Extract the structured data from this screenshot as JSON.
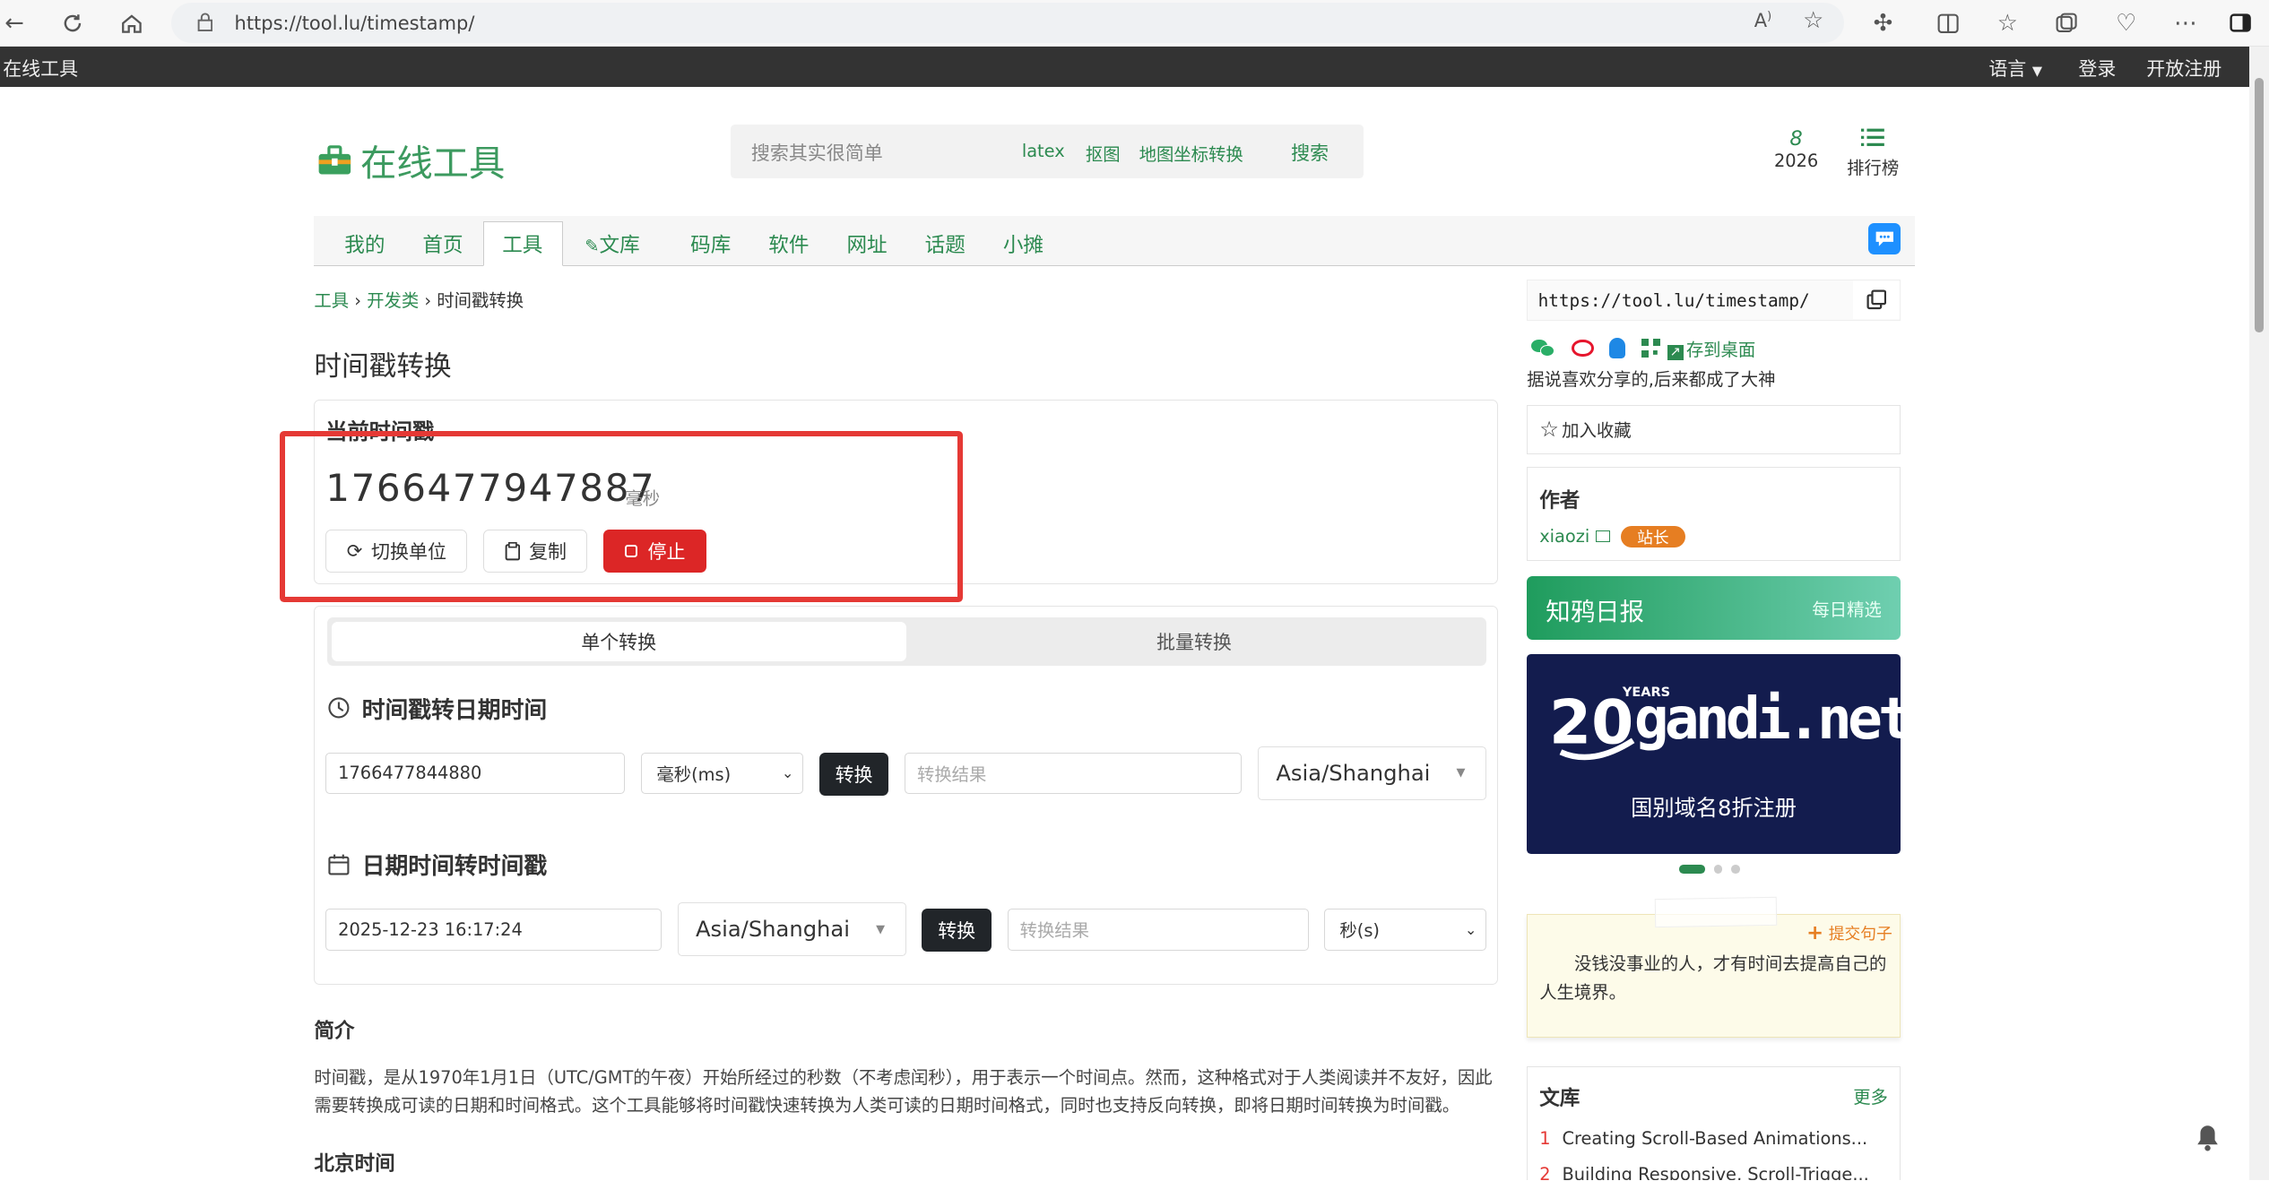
{
  "browser": {
    "url": "https://tool.lu/timestamp/"
  },
  "topbar": {
    "site": "在线工具",
    "language": "语言",
    "login": "登录",
    "register": "开放注册"
  },
  "header": {
    "logo": "在线工具",
    "search_placeholder": "搜索其实很简单",
    "tags": [
      "latex",
      "抠图",
      "地图坐标转换"
    ],
    "search_button": "搜索",
    "year_icon": "8",
    "year": "2026",
    "rank": "排行榜"
  },
  "nav": [
    "我的",
    "首页",
    "工具",
    "文库",
    "码库",
    "软件",
    "网址",
    "话题",
    "小摊"
  ],
  "breadcrumb": {
    "a": "工具",
    "b": "开发类",
    "c": "时间戳转换",
    "sep": "›"
  },
  "page_title": "时间戳转换",
  "current": {
    "label": "当前时间戳",
    "value": "1766477947887",
    "unit": "毫秒",
    "switch": "切换单位",
    "copy": "复制",
    "stop": "停止"
  },
  "tabs": {
    "single": "单个转换",
    "batch": "批量转换"
  },
  "ts2date": {
    "title": "时间戳转日期时间",
    "input": "1766477844880",
    "unit": "毫秒(ms)",
    "button": "转换",
    "result_placeholder": "转换结果",
    "tz": "Asia/Shanghai"
  },
  "date2ts": {
    "title": "日期时间转时间戳",
    "input": "2025-12-23 16:17:24",
    "tz": "Asia/Shanghai",
    "button": "转换",
    "result_placeholder": "转换结果",
    "unit": "秒(s)"
  },
  "intro": {
    "title": "简介",
    "line1": "时间戳，是从1970年1月1日（UTC/GMT的午夜）开始所经过的秒数（不考虑闰秒），用于表示一个时间点。然而，这种格式对于人类阅读并不友好，因此",
    "line2": "需要转换成可读的日期和时间格式。这个工具能够将时间戳快速转换为人类可读的日期时间格式，同时也支持反向转换，即将日期时间转换为时间戳。"
  },
  "beijing": {
    "title": "北京时间"
  },
  "sidebar": {
    "share_url": "https://tool.lu/timestamp/",
    "save_desktop": "存到桌面",
    "share_text": "据说喜欢分享的,后来都成了大神",
    "favorite": "加入收藏",
    "author_title": "作者",
    "author": "xiaozi",
    "badge": "站长",
    "daily_title": "知鸦日报",
    "daily_sub": "每日精选",
    "ad_years": "YEARS",
    "ad_brand": "gandi.net",
    "ad_text": "国别域名8折注册",
    "submit_quote": "提交句子",
    "quote": "没钱没事业的人，才有时间去提高自己的人生境界。",
    "library_title": "文库",
    "library_more": "更多",
    "library_items": [
      {
        "num": "1",
        "title": "Creating Scroll-Based Animations..."
      },
      {
        "num": "2",
        "title": "Building Responsive, Scroll-Trigge..."
      }
    ]
  },
  "colors": {
    "brand_green": "#2c8a50",
    "stop_red": "#dc2626",
    "highlight": "#e53935",
    "dark": "#212529"
  }
}
